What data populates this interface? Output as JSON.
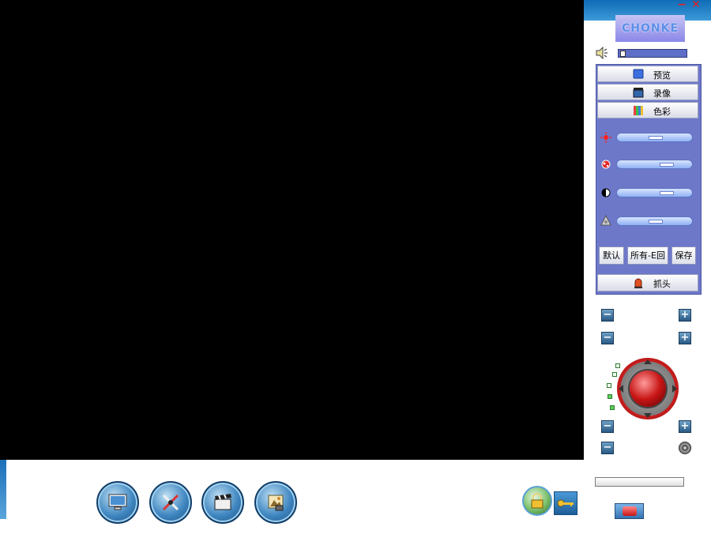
{
  "window": {
    "minimize_label": "−",
    "close_label": "✕",
    "logo_text": "CHONKE"
  },
  "panel": {
    "tabs": [
      {
        "label": "预览",
        "icon": "monitor-icon"
      },
      {
        "label": "录像",
        "icon": "film-icon"
      },
      {
        "label": "色彩",
        "icon": "color-bars-icon"
      }
    ],
    "adjust_icons": [
      "brightness-icon",
      "saturation-icon",
      "contrast-icon",
      "hue-icon"
    ],
    "buttons": {
      "default": "默认",
      "all_restore": "所有-E回",
      "save": "保存"
    },
    "capture_label": "抓头"
  },
  "ptz": {
    "minus_label": "−",
    "plus_label": "+"
  },
  "bottom_toolbar": {
    "icons": [
      "monitor-icon",
      "tools-icon",
      "clapper-icon",
      "photo-icon",
      "lock-icon",
      "key-icon"
    ]
  },
  "colors": {
    "title_bar": "#1f7fc8",
    "panel_bg": "#6d78c9",
    "video_bg": "#000000"
  }
}
